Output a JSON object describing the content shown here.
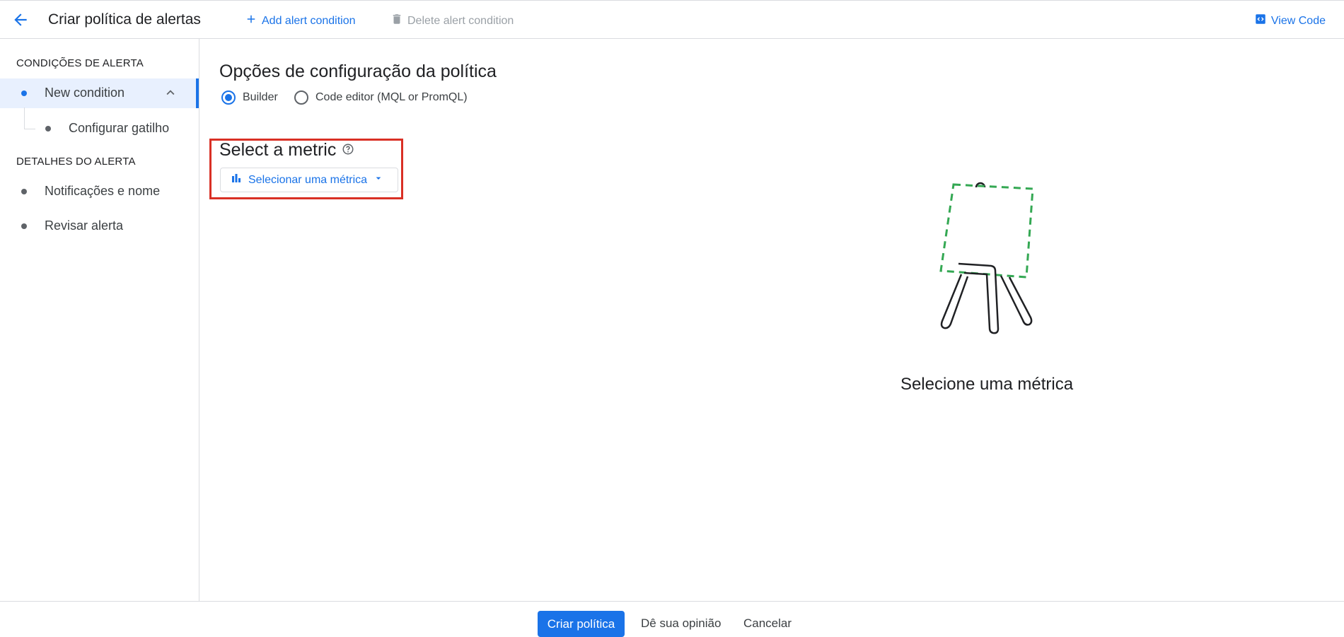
{
  "header": {
    "title": "Criar política de alertas",
    "add_condition_label": "Add alert condition",
    "delete_condition_label": "Delete alert condition",
    "view_code_label": "View Code"
  },
  "sidebar": {
    "conditions_heading": "CONDIÇÕES DE ALERTA",
    "new_condition_label": "New condition",
    "trigger_label": "Configurar gatilho",
    "details_heading": "DETALHES DO ALERTA",
    "notifications_label": "Notificações e nome",
    "review_label": "Revisar alerta"
  },
  "main": {
    "config_title": "Opções de configuração da política",
    "builder_label": "Builder",
    "code_editor_label": "Code editor (MQL or PromQL)",
    "selected_mode": "Builder",
    "metric_heading": "Select a metric",
    "metric_button_label": "Selecionar uma métrica",
    "empty_state_text": "Selecione uma métrica"
  },
  "footer": {
    "create_label": "Criar política",
    "feedback_label": "Dê sua opinião",
    "cancel_label": "Cancelar"
  },
  "colors": {
    "accent": "#1a73e8",
    "highlight": "#d93025",
    "illustration_dash": "#34a853"
  }
}
